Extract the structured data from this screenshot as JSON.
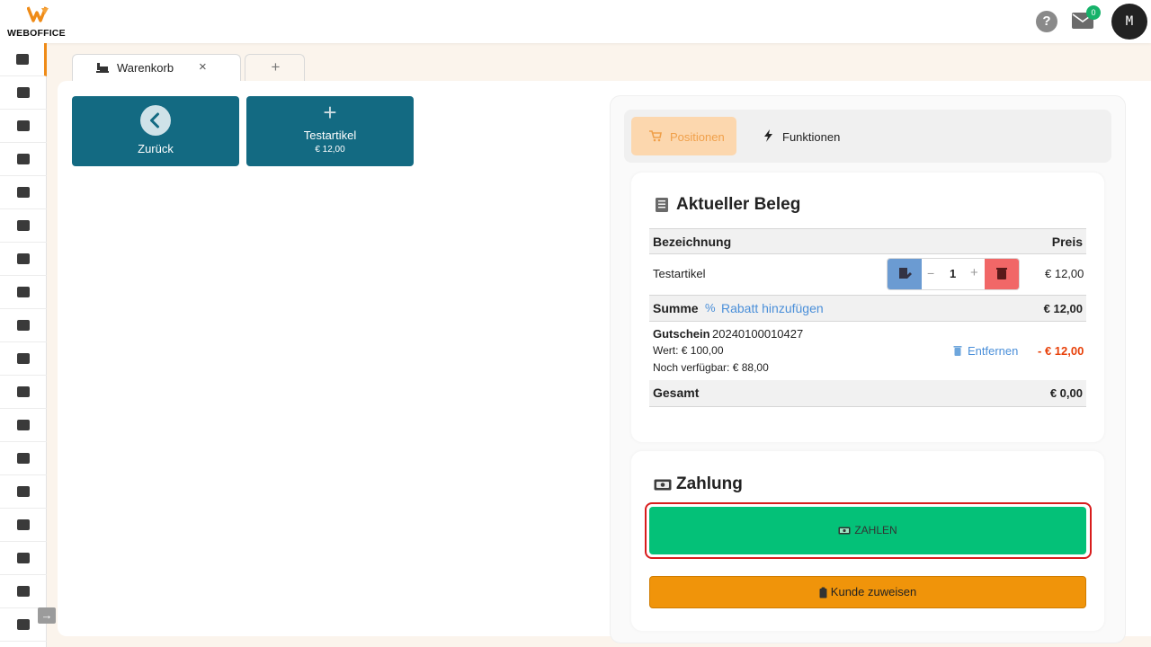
{
  "brand": {
    "name": "WEBOFFICE"
  },
  "header": {
    "help_label": "?",
    "mail_count": "0",
    "avatar_initial": "M"
  },
  "sidebar": {
    "items": [
      {
        "icon": "pos-register-icon"
      },
      {
        "icon": "calendar-icon"
      },
      {
        "icon": "crown-icon"
      },
      {
        "icon": "network-icon"
      },
      {
        "icon": "clock-icon"
      },
      {
        "icon": "document-icon"
      },
      {
        "icon": "receipt-icon"
      },
      {
        "icon": "boxes-icon"
      },
      {
        "icon": "megaphone-icon"
      },
      {
        "icon": "report-icon"
      },
      {
        "icon": "folder-icon"
      },
      {
        "icon": "database-icon"
      },
      {
        "icon": "cart-icon"
      },
      {
        "icon": "warehouse-icon"
      },
      {
        "icon": "factory-icon"
      },
      {
        "icon": "users-icon"
      },
      {
        "icon": "truck-icon"
      },
      {
        "icon": "key-icon"
      }
    ],
    "expand_label": "→"
  },
  "tabs": [
    {
      "label": "Warenkorb",
      "close": "×"
    },
    {
      "label": "+"
    }
  ],
  "tiles": {
    "back": {
      "label": "Zurück"
    },
    "article": {
      "plus": "+",
      "label": "Testartikel",
      "price": "€ 12,00"
    }
  },
  "segments": {
    "active": "Positionen",
    "other": "Funktionen"
  },
  "receipt": {
    "title": "Aktueller Beleg",
    "col_name": "Bezeichnung",
    "col_price": "Preis",
    "item": {
      "name": "Testartikel",
      "qty": "1",
      "minus": "−",
      "plus": "+",
      "price": "€ 12,00"
    },
    "sum_label": "Summe",
    "discount_link": "Rabatt hinzufügen",
    "sum_value": "€ 12,00",
    "voucher": {
      "label": "Gutschein",
      "code": "20240100010427",
      "value": "Wert: € 100,00",
      "remaining": "Noch verfügbar: € 88,00",
      "remove": "Entfernen",
      "amount": "- € 12,00"
    },
    "total_label": "Gesamt",
    "total_value": "€ 0,00"
  },
  "payment": {
    "title": "Zahlung",
    "pay_button": "ZAHLEN",
    "customer_button": "Kunde zuweisen"
  },
  "colors": {
    "accent": "#ef8b17",
    "tile": "#136a82",
    "pay": "#04c178",
    "customer": "#f0940a",
    "danger": "#e8410a",
    "link": "#4a8fd9"
  }
}
